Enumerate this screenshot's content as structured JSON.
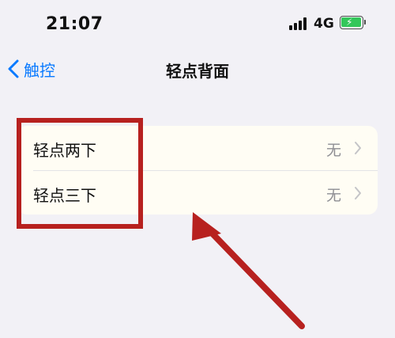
{
  "status_bar": {
    "time": "21:07",
    "network": "4G",
    "battery_charging": true
  },
  "nav": {
    "back_label": "触控",
    "title": "轻点背面"
  },
  "settings": {
    "rows": [
      {
        "label": "轻点两下",
        "value": "无"
      },
      {
        "label": "轻点三下",
        "value": "无"
      }
    ]
  },
  "colors": {
    "accent": "#0a7aff",
    "highlight": "#b7211f",
    "battery": "#33c75a",
    "background": "#f2f1f6"
  },
  "icons": [
    "signal-icon",
    "battery-icon",
    "back-chevron-icon",
    "chevron-right-icon",
    "annotation-arrow"
  ]
}
